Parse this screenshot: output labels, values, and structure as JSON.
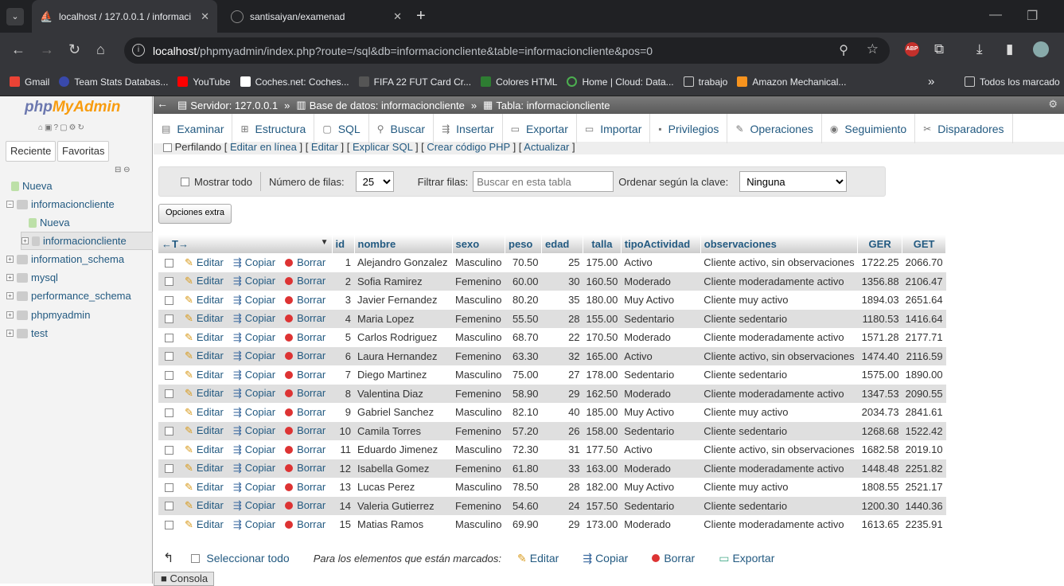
{
  "browser": {
    "tab1_title": "localhost / 127.0.0.1 / informaci",
    "tab2_title": "santisaiyan/examenad",
    "url_host": "localhost",
    "url_path": "/phpmyadmin/index.php?route=/sql&db=informacioncliente&table=informacioncliente&pos=0",
    "bookmarks": [
      "Gmail",
      "Team Stats Databas...",
      "YouTube",
      "Coches.net: Coches...",
      "FIFA 22 FUT Card Cr...",
      "Colores HTML",
      "Home | Cloud: Data...",
      "trabajo",
      "Amazon Mechanical..."
    ],
    "more": "»",
    "all_bookmarks": "Todos los marcado",
    "abp": "ABP"
  },
  "sidebar": {
    "logo_php": "php",
    "logo_my": "MyAdmin",
    "reciente": "Reciente",
    "favoritas": "Favoritas",
    "tree": [
      "Nueva",
      "informacioncliente",
      "Nueva",
      "informacioncliente",
      "information_schema",
      "mysql",
      "performance_schema",
      "phpmyadmin",
      "test"
    ]
  },
  "breadcrumb": {
    "server": "Servidor: 127.0.0.1",
    "db": "Base de datos: informacioncliente",
    "table": "Tabla: informacioncliente"
  },
  "tabs": [
    "Examinar",
    "Estructura",
    "SQL",
    "Buscar",
    "Insertar",
    "Exportar",
    "Importar",
    "Privilegios",
    "Operaciones",
    "Seguimiento",
    "Disparadores"
  ],
  "profiling": {
    "label": "Perfilando",
    "links": [
      "Editar en línea",
      "Editar",
      "Explicar SQL",
      "Crear código PHP",
      "Actualizar"
    ]
  },
  "filter": {
    "show_all": "Mostrar todo",
    "rows_label": "Número de filas:",
    "rows_value": "25",
    "filter_label": "Filtrar filas:",
    "filter_placeholder": "Buscar en esta tabla",
    "sort_label": "Ordenar según la clave:",
    "sort_value": "Ninguna"
  },
  "extra_options": "Opciones extra",
  "table": {
    "arrows": "←T→",
    "columns": [
      "id",
      "nombre",
      "sexo",
      "peso",
      "edad",
      "talla",
      "tipoActividad",
      "observaciones",
      "GER",
      "GET"
    ],
    "action_edit": "Editar",
    "action_copy": "Copiar",
    "action_delete": "Borrar",
    "rows": [
      [
        "1",
        "Alejandro Gonzalez",
        "Masculino",
        "70.50",
        "25",
        "175.00",
        "Activo",
        "Cliente activo, sin observaciones",
        "1722.25",
        "2066.70"
      ],
      [
        "2",
        "Sofia Ramirez",
        "Femenino",
        "60.00",
        "30",
        "160.50",
        "Moderado",
        "Cliente moderadamente activo",
        "1356.88",
        "2106.47"
      ],
      [
        "3",
        "Javier Fernandez",
        "Masculino",
        "80.20",
        "35",
        "180.00",
        "Muy Activo",
        "Cliente muy activo",
        "1894.03",
        "2651.64"
      ],
      [
        "4",
        "Maria Lopez",
        "Femenino",
        "55.50",
        "28",
        "155.00",
        "Sedentario",
        "Cliente sedentario",
        "1180.53",
        "1416.64"
      ],
      [
        "5",
        "Carlos Rodriguez",
        "Masculino",
        "68.70",
        "22",
        "170.50",
        "Moderado",
        "Cliente moderadamente activo",
        "1571.28",
        "2177.71"
      ],
      [
        "6",
        "Laura Hernandez",
        "Femenino",
        "63.30",
        "32",
        "165.00",
        "Activo",
        "Cliente activo, sin observaciones",
        "1474.40",
        "2116.59"
      ],
      [
        "7",
        "Diego Martinez",
        "Masculino",
        "75.00",
        "27",
        "178.00",
        "Sedentario",
        "Cliente sedentario",
        "1575.00",
        "1890.00"
      ],
      [
        "8",
        "Valentina Diaz",
        "Femenino",
        "58.90",
        "29",
        "162.50",
        "Moderado",
        "Cliente moderadamente activo",
        "1347.53",
        "2090.55"
      ],
      [
        "9",
        "Gabriel Sanchez",
        "Masculino",
        "82.10",
        "40",
        "185.00",
        "Muy Activo",
        "Cliente muy activo",
        "2034.73",
        "2841.61"
      ],
      [
        "10",
        "Camila Torres",
        "Femenino",
        "57.20",
        "26",
        "158.00",
        "Sedentario",
        "Cliente sedentario",
        "1268.68",
        "1522.42"
      ],
      [
        "11",
        "Eduardo Jimenez",
        "Masculino",
        "72.30",
        "31",
        "177.50",
        "Activo",
        "Cliente activo, sin observaciones",
        "1682.58",
        "2019.10"
      ],
      [
        "12",
        "Isabella Gomez",
        "Femenino",
        "61.80",
        "33",
        "163.00",
        "Moderado",
        "Cliente moderadamente activo",
        "1448.48",
        "2251.82"
      ],
      [
        "13",
        "Lucas Perez",
        "Masculino",
        "78.50",
        "28",
        "182.00",
        "Muy Activo",
        "Cliente muy activo",
        "1808.55",
        "2521.17"
      ],
      [
        "14",
        "Valeria Gutierrez",
        "Femenino",
        "54.60",
        "24",
        "157.50",
        "Sedentario",
        "Cliente sedentario",
        "1200.30",
        "1440.36"
      ],
      [
        "15",
        "Matias Ramos",
        "Masculino",
        "69.90",
        "29",
        "173.00",
        "Moderado",
        "Cliente moderadamente activo",
        "1613.65",
        "2235.91"
      ]
    ]
  },
  "bottom": {
    "select_all": "Seleccionar todo",
    "marked": "Para los elementos que están marcados:",
    "edit": "Editar",
    "copy": "Copiar",
    "delete": "Borrar",
    "export": "Exportar"
  },
  "console": "Consola"
}
